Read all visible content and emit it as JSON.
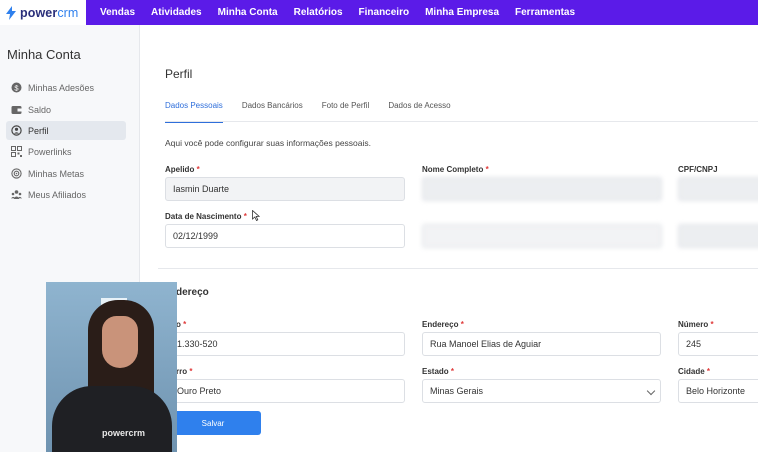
{
  "brand": {
    "name_bold": "power",
    "name_light": "crm"
  },
  "nav": [
    "Vendas",
    "Atividades",
    "Minha Conta",
    "Relatórios",
    "Financeiro",
    "Minha Empresa",
    "Ferramentas"
  ],
  "sidebar": {
    "title": "Minha Conta",
    "items": [
      {
        "label": "Minhas Adesões",
        "icon": "dollar-icon"
      },
      {
        "label": "Saldo",
        "icon": "wallet-icon"
      },
      {
        "label": "Perfil",
        "icon": "user-icon",
        "active": true
      },
      {
        "label": "Powerlinks",
        "icon": "qr-icon"
      },
      {
        "label": "Minhas Metas",
        "icon": "target-icon"
      },
      {
        "label": "Meus Afiliados",
        "icon": "users-icon"
      }
    ]
  },
  "page": {
    "title": "Perfil",
    "tabs": [
      "Dados Pessoais",
      "Dados Bancários",
      "Foto de Perfil",
      "Dados de Acesso"
    ],
    "intro": "Aqui você pode configurar suas informações pessoais."
  },
  "personal": {
    "apelido_label": "Apelido",
    "apelido_value": "Iasmin Duarte",
    "nome_label": "Nome Completo",
    "cpf_label": "CPF/CNPJ",
    "nascimento_label": "Data de Nascimento",
    "nascimento_value": "02/12/1999"
  },
  "address": {
    "section_title": "dereço",
    "cep_label": "o",
    "cep_value": "1.330-520",
    "endereco_label": "Endereço",
    "endereco_value": "Rua Manoel Elias de Aguiar",
    "numero_label": "Número",
    "numero_value": "245",
    "bairro_label": "rro",
    "bairro_value": "Ouro Preto",
    "estado_label": "Estado",
    "estado_value": "Minas Gerais",
    "cidade_label": "Cidade",
    "cidade_value": "Belo Horizonte"
  },
  "actions": {
    "save_label": "Salvar"
  },
  "webcam": {
    "shirt_text": "powercrm"
  },
  "required_mark": "*",
  "colors": {
    "nav_bg": "#5b1be8",
    "accent": "#2f80ed",
    "required": "#e03b3b"
  }
}
